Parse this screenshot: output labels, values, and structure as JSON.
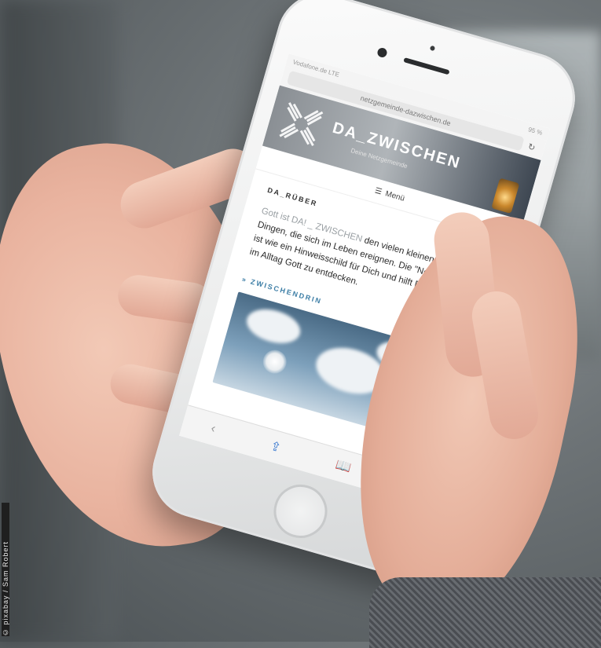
{
  "credit": "© pixabay / Sam Robert",
  "browser": {
    "status_left": "Vodafone.de  LTE",
    "status_right": "95 %",
    "url": "netzgemeinde-dazwischen.de",
    "reload_icon": "reload-icon"
  },
  "site": {
    "brand": "DA_ZWISCHEN",
    "tagline": "Deine Netzgemeinde",
    "menu_label": "Menü",
    "section_title": "DA_RÜBER",
    "paragraph_muted": "Gott ist DA! _ ZWISCHEN",
    "paragraph_rest": " den vielen kleinen und großen Dingen, die sich im Leben ereignen. Die \"Netzgemeinde\" ist wie ein Hinweisschild für Dich und hilft Dir dabei, mitten im Alltag Gott zu entdecken.",
    "link_title": "» ZWISCHENDRIN"
  },
  "toolbar": {
    "back_icon": "‹",
    "share_icon": "⇪",
    "bookmarks_icon": "📖",
    "tabs_icon": "❐"
  },
  "colors": {
    "link": "#3d7ea6",
    "ios_blue": "#3b7ad0"
  }
}
